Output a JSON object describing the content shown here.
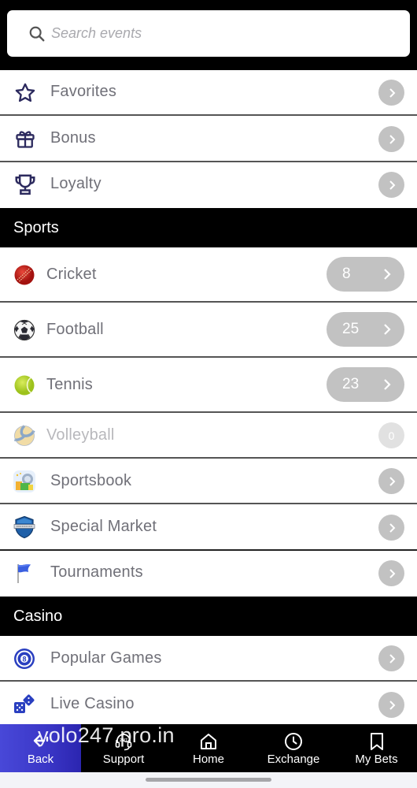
{
  "search": {
    "placeholder": "Search events",
    "value": ""
  },
  "quick_links": [
    {
      "label": "Favorites",
      "icon": "star-icon"
    },
    {
      "label": "Bonus",
      "icon": "gift-icon"
    },
    {
      "label": "Loyalty",
      "icon": "trophy-icon"
    }
  ],
  "sports": {
    "header": "Sports",
    "items": [
      {
        "label": "Cricket",
        "icon": "cricket-ball-icon",
        "count": "8"
      },
      {
        "label": "Football",
        "icon": "football-icon",
        "count": "25"
      },
      {
        "label": "Tennis",
        "icon": "tennis-ball-icon",
        "count": "23"
      },
      {
        "label": "Volleyball",
        "icon": "volleyball-icon",
        "count": "0",
        "disabled": true
      },
      {
        "label": "Sportsbook",
        "icon": "sportsbook-icon"
      },
      {
        "label": "Special Market",
        "icon": "special-market-shield-icon"
      },
      {
        "label": "Tournaments",
        "icon": "flag-icon"
      }
    ]
  },
  "casino": {
    "header": "Casino",
    "items": [
      {
        "label": "Popular Games",
        "icon": "eight-ball-icon"
      },
      {
        "label": "Live Casino",
        "icon": "dice-icon"
      }
    ]
  },
  "bottom_nav": [
    {
      "label": "Back",
      "icon": "back-arrow-icon",
      "active": true
    },
    {
      "label": "Support",
      "icon": "support-headset-icon"
    },
    {
      "label": "Home",
      "icon": "home-icon"
    },
    {
      "label": "Exchange",
      "icon": "clock-icon"
    },
    {
      "label": "My Bets",
      "icon": "bookmark-icon"
    }
  ],
  "watermark": "yolo247.pro.in",
  "colors": {
    "accent": "#3a36c6",
    "icon_navy": "#2c2a5e",
    "chevron_bg": "#c2c2c2",
    "label_text": "#707078"
  }
}
